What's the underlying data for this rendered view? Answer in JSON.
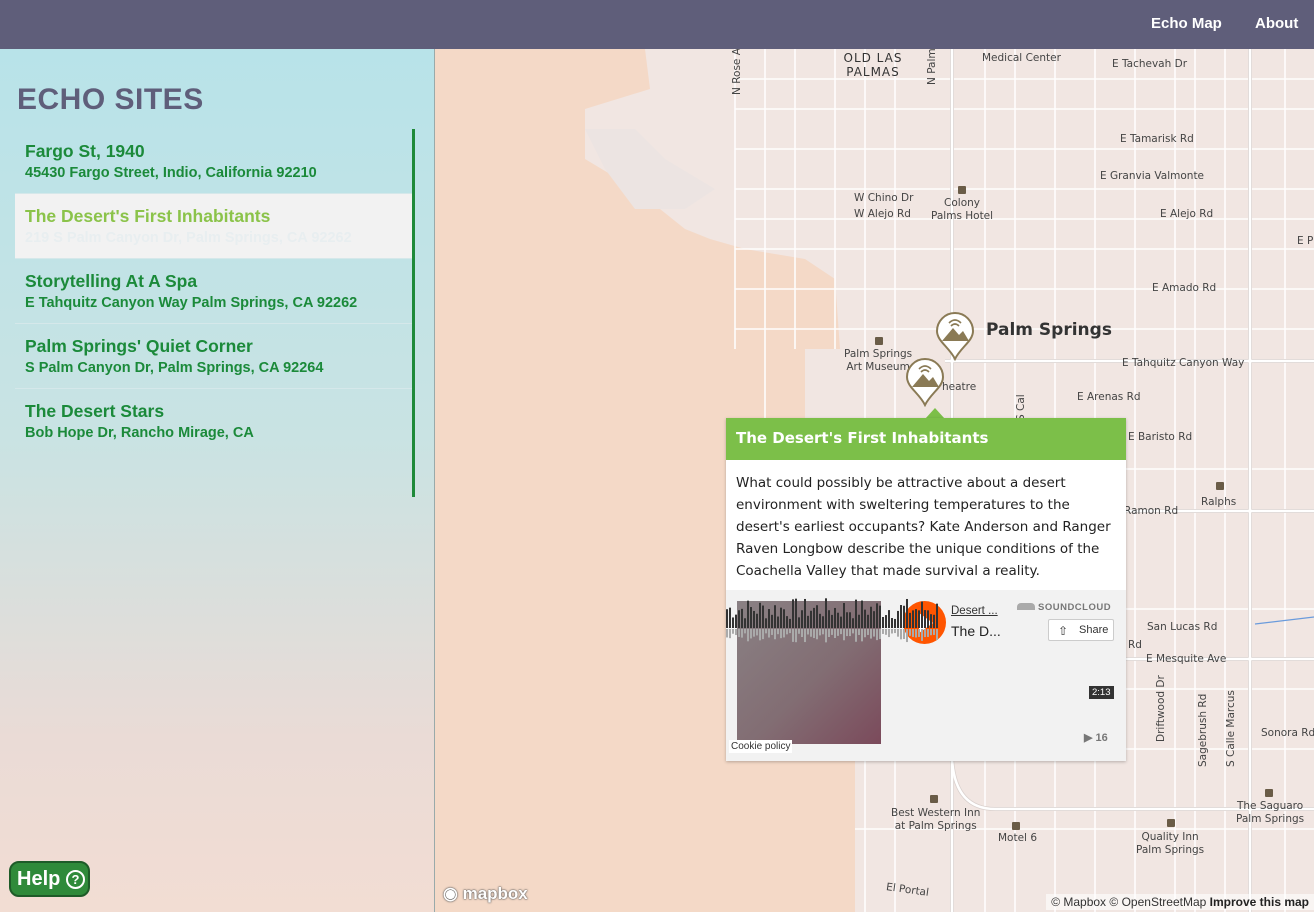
{
  "nav": {
    "echo_map": "Echo Map",
    "about": "About"
  },
  "sidebar": {
    "title": "ECHO SITES",
    "sites": [
      {
        "name": "Fargo St, 1940",
        "address": "45430 Fargo Street, Indio, California 92210"
      },
      {
        "name": "The Desert's First Inhabitants",
        "address": "219 S Palm Canyon Dr, Palm Springs, CA 92262"
      },
      {
        "name": "Storytelling At A Spa",
        "address": "E Tahquitz Canyon Way Palm Springs, CA 92262"
      },
      {
        "name": "Palm Springs' Quiet Corner",
        "address": "S Palm Canyon Dr, Palm Springs, CA 92264"
      },
      {
        "name": "The Desert Stars",
        "address": "Bob Hope Dr, Rancho Mirage, CA"
      }
    ],
    "help": "Help",
    "help_icon": "?"
  },
  "map": {
    "labels": {
      "old_las_palmas": "OLD LAS PALMAS",
      "n_rose": "N Rose Av",
      "n_palm": "N Palm",
      "medical_center": "Medical Center",
      "tachevah": "E Tachevah Dr",
      "tamarisk": "E Tamarisk Rd",
      "granvia": "E Granvia Valmonte",
      "chino": "W Chino Dr",
      "alejo_w": "W Alejo Rd",
      "colony": "Colony\nPalms Hotel",
      "alejo_e": "E Alejo Rd",
      "amado": "E Amado Rd",
      "palm_springs": "Palm Springs",
      "art_museum": "Palm Springs\nArt Museum",
      "theatre": "heatre",
      "tahquitz": "E Tahquitz Canyon Way",
      "arenas": "E Arenas Rd",
      "baristo": "E Baristo Rd",
      "s_cal": "S Cal",
      "ralphs": "Ralphs",
      "ramon": "Ramon Rd",
      "san_lucas": "San Lucas Rd",
      "rd": "Rd",
      "mesquite": "E Mesquite Ave",
      "driftwood": "Driftwood Dr",
      "sagebrush": "Sagebrush Rd",
      "calle_marcus": "S Calle Marcus",
      "sonora": "Sonora Rd",
      "best_western": "Best Western Inn\nat Palm Springs",
      "motel6": "Motel 6",
      "quality_inn": "Quality Inn\nPalm Springs",
      "saguaro": "The Saguaro\nPalm Springs",
      "el_portal": "El Portal",
      "e_p": "E P"
    },
    "popup": {
      "title": "The Desert's First Inhabitants",
      "body": "What could possibly be attractive about a desert environment with sweltering temperatures to the desert's earliest occupants? Kate Anderson and Ranger Raven Longbow describe the unique conditions of the Coachella Valley that made survival a reality.",
      "player": {
        "artist": "Desert ...",
        "track": "The D...",
        "brand": "SOUNDCLOUD",
        "share": "Share",
        "duration": "2:13",
        "plays": "16",
        "cookie": "Cookie policy"
      }
    },
    "logo": "mapbox",
    "attribution": {
      "mapbox": "© Mapbox",
      "osm": "© OpenStreetMap",
      "improve": "Improve this map"
    }
  }
}
